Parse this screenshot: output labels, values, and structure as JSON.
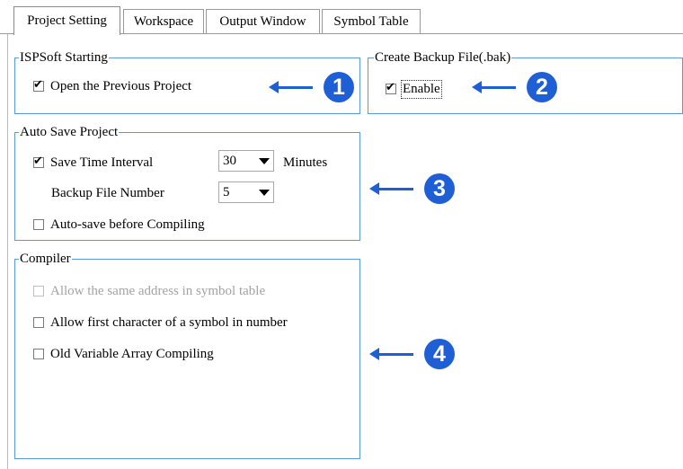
{
  "tabs": [
    {
      "label": "Project Setting",
      "active": true
    },
    {
      "label": "Workspace",
      "active": false
    },
    {
      "label": "Output Window",
      "active": false
    },
    {
      "label": "Symbol Table",
      "active": false
    }
  ],
  "ispsoft_starting": {
    "title": "ISPSoft Starting",
    "open_previous": {
      "label": "Open the Previous Project",
      "checked": true
    }
  },
  "backup": {
    "title": "Create Backup File(.bak)",
    "enable": {
      "label": "Enable",
      "checked": true
    }
  },
  "auto_save": {
    "title": "Auto Save Project",
    "save_interval": {
      "label": "Save Time Interval",
      "checked": true,
      "value": "30",
      "unit": "Minutes"
    },
    "backup_number": {
      "label": "Backup File Number",
      "value": "5"
    },
    "before_compiling": {
      "label": "Auto-save before Compiling",
      "checked": false
    }
  },
  "compiler": {
    "title": "Compiler",
    "same_address": {
      "label": "Allow the same address in symbol table",
      "checked": false,
      "enabled": false
    },
    "first_char_number": {
      "label": "Allow first character of a symbol in number",
      "checked": false
    },
    "old_array": {
      "label": "Old Variable Array Compiling",
      "checked": false
    }
  },
  "callouts": [
    "1",
    "2",
    "3",
    "4"
  ],
  "colors": {
    "accent": "#1f5fd6",
    "group_border": "#5b9bd5",
    "disabled_text": "#a3a3a3"
  }
}
